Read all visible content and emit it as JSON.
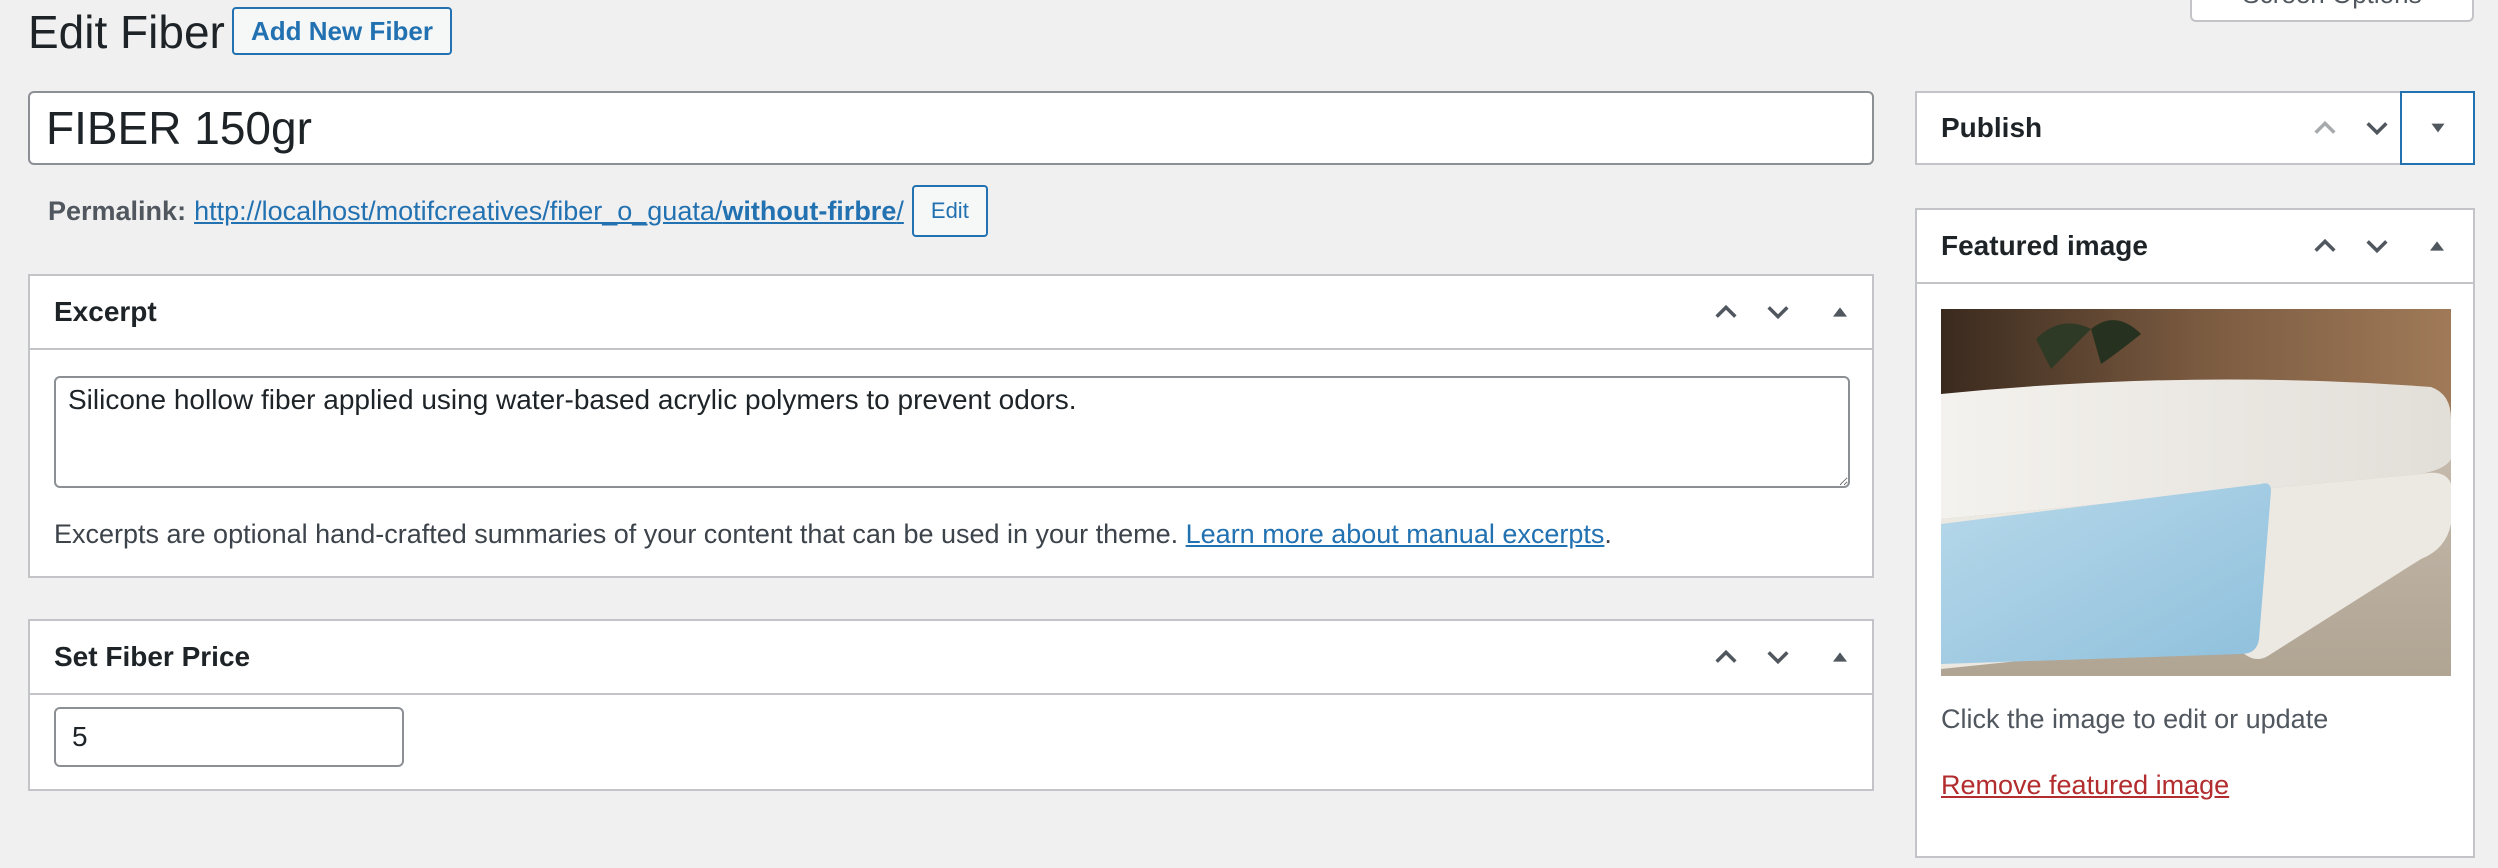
{
  "header": {
    "title": "Edit Fiber",
    "add_new_label": "Add New Fiber",
    "screen_options_label": "Screen Options"
  },
  "post": {
    "title_value": "FIBER 150gr"
  },
  "permalink": {
    "label": "Permalink:",
    "url_base": "http://localhost/motifcreatives/fiber_o_guata/",
    "slug": "without-firbre",
    "url_end": "/",
    "edit_label": "Edit"
  },
  "excerpt_box": {
    "title": "Excerpt",
    "value": "Silicone hollow fiber applied using water-based acrylic polymers to prevent odors.",
    "help_text": "Excerpts are optional hand-crafted summaries of your content that can be used in your theme.",
    "help_link": "Learn more about manual excerpts",
    "help_end": "."
  },
  "price_box": {
    "title": "Set Fiber Price",
    "value": "5"
  },
  "publish_box": {
    "title": "Publish"
  },
  "featured_box": {
    "title": "Featured image",
    "help_text": "Click the image to edit or update",
    "remove_label": "Remove featured image"
  },
  "icons": {
    "move_up": "chevron-up-icon",
    "move_down": "chevron-down-icon",
    "toggle_collapse": "triangle-up-icon",
    "toggle_expand": "triangle-down-icon"
  },
  "colors": {
    "accent": "#2271b1",
    "danger": "#b32d2e",
    "background": "#f0f0f1",
    "border": "#c3c4c7"
  }
}
